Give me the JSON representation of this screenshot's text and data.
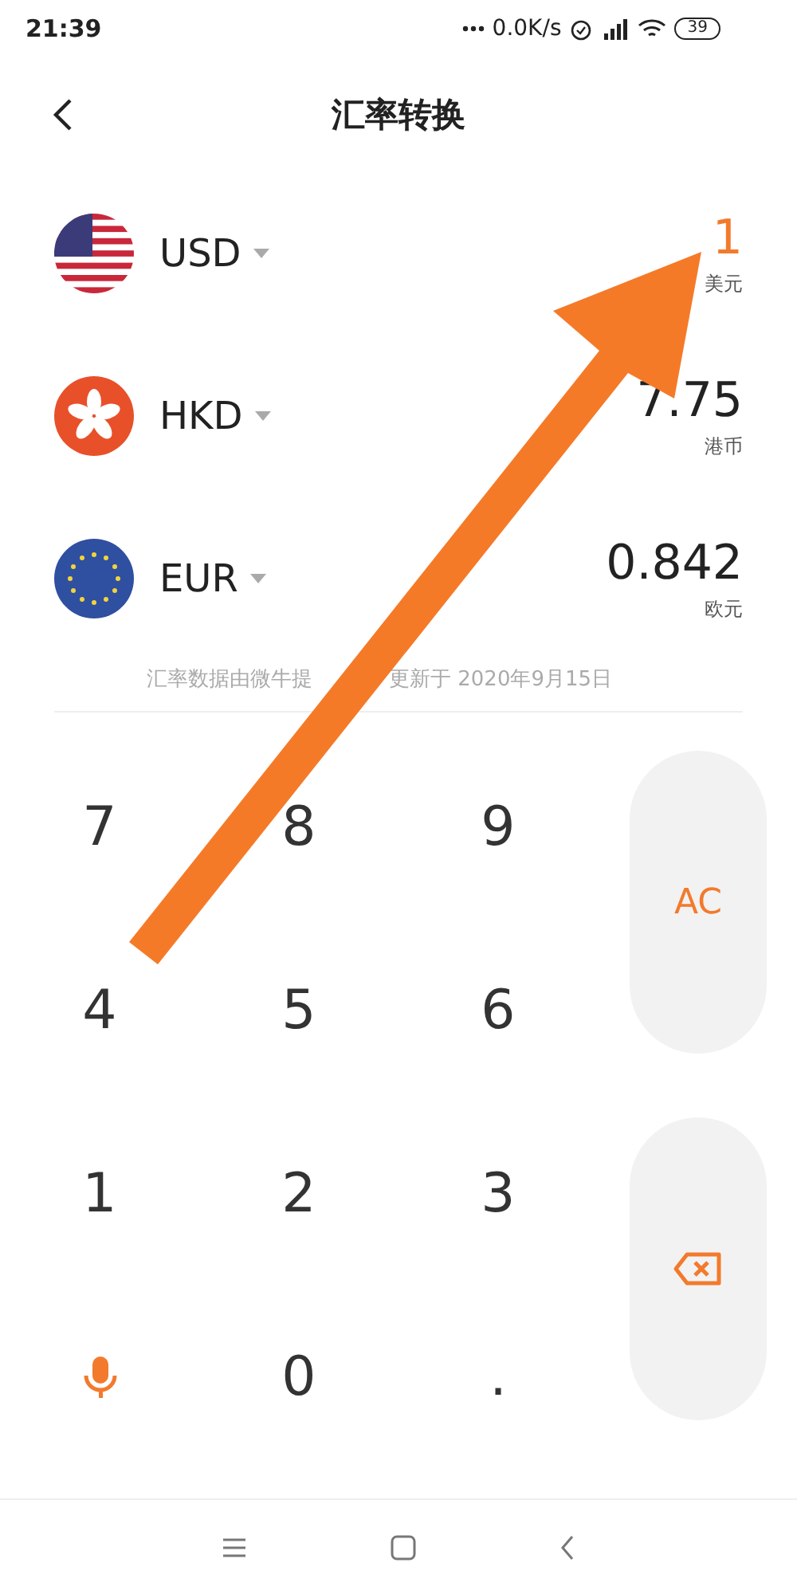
{
  "status_bar": {
    "time": "21:39",
    "speed": "0.0K/s",
    "battery": "39"
  },
  "header": {
    "title": "汇率转换"
  },
  "currencies": [
    {
      "code": "USD",
      "kind": "us",
      "value": "1",
      "name": "美元",
      "selected": true
    },
    {
      "code": "HKD",
      "kind": "hk",
      "value": "7.75",
      "name": "港币",
      "selected": false
    },
    {
      "code": "EUR",
      "kind": "eu",
      "value": "0.842",
      "name": "欧元",
      "selected": false
    }
  ],
  "footer_note": [
    "汇率数据由微牛提",
    "更新于 2020年9月15日"
  ],
  "keypad": [
    {
      "kind": "digit",
      "label": "7"
    },
    {
      "kind": "digit",
      "label": "8"
    },
    {
      "kind": "digit",
      "label": "9"
    },
    {
      "kind": "digit",
      "label": "4"
    },
    {
      "kind": "digit",
      "label": "5"
    },
    {
      "kind": "digit",
      "label": "6"
    },
    {
      "kind": "digit",
      "label": "1"
    },
    {
      "kind": "digit",
      "label": "2"
    },
    {
      "kind": "digit",
      "label": "3"
    },
    {
      "kind": "mic"
    },
    {
      "kind": "digit",
      "label": "0"
    },
    {
      "kind": "digit",
      "label": "."
    }
  ],
  "side_keys": [
    {
      "kind": "clear",
      "label": "AC"
    },
    {
      "kind": "backspace"
    }
  ],
  "annotation": {
    "kind": "arrow"
  }
}
